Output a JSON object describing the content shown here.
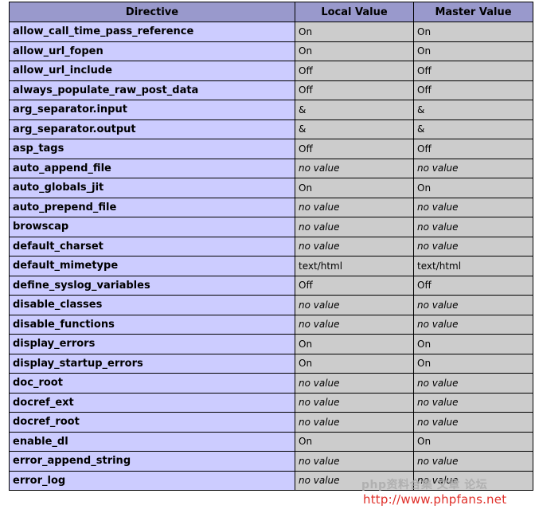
{
  "table": {
    "headers": [
      "Directive",
      "Local Value",
      "Master Value"
    ],
    "rows": [
      {
        "directive": "allow_call_time_pass_reference",
        "local": "On",
        "master": "On"
      },
      {
        "directive": "allow_url_fopen",
        "local": "On",
        "master": "On"
      },
      {
        "directive": "allow_url_include",
        "local": "Off",
        "master": "Off"
      },
      {
        "directive": "always_populate_raw_post_data",
        "local": "Off",
        "master": "Off"
      },
      {
        "directive": "arg_separator.input",
        "local": "&",
        "master": "&"
      },
      {
        "directive": "arg_separator.output",
        "local": "&",
        "master": "&"
      },
      {
        "directive": "asp_tags",
        "local": "Off",
        "master": "Off"
      },
      {
        "directive": "auto_append_file",
        "local": "no value",
        "master": "no value"
      },
      {
        "directive": "auto_globals_jit",
        "local": "On",
        "master": "On"
      },
      {
        "directive": "auto_prepend_file",
        "local": "no value",
        "master": "no value"
      },
      {
        "directive": "browscap",
        "local": "no value",
        "master": "no value"
      },
      {
        "directive": "default_charset",
        "local": "no value",
        "master": "no value"
      },
      {
        "directive": "default_mimetype",
        "local": "text/html",
        "master": "text/html"
      },
      {
        "directive": "define_syslog_variables",
        "local": "Off",
        "master": "Off"
      },
      {
        "directive": "disable_classes",
        "local": "no value",
        "master": "no value"
      },
      {
        "directive": "disable_functions",
        "local": "no value",
        "master": "no value"
      },
      {
        "directive": "display_errors",
        "local": "On",
        "master": "On"
      },
      {
        "directive": "display_startup_errors",
        "local": "On",
        "master": "On"
      },
      {
        "directive": "doc_root",
        "local": "no value",
        "master": "no value"
      },
      {
        "directive": "docref_ext",
        "local": "no value",
        "master": "no value"
      },
      {
        "directive": "docref_root",
        "local": "no value",
        "master": "no value"
      },
      {
        "directive": "enable_dl",
        "local": "On",
        "master": "On"
      },
      {
        "directive": "error_append_string",
        "local": "no value",
        "master": "no value"
      },
      {
        "directive": "error_log",
        "local": "no value",
        "master": "no value"
      }
    ]
  },
  "watermark": {
    "line1": "php资料合集 文章 论坛",
    "line2": "http://www.phpfans.net"
  },
  "colors": {
    "header_bg": "#9999cc",
    "directive_bg": "#ccccff",
    "value_bg": "#cccccc",
    "watermark_red": "#e0302a"
  }
}
